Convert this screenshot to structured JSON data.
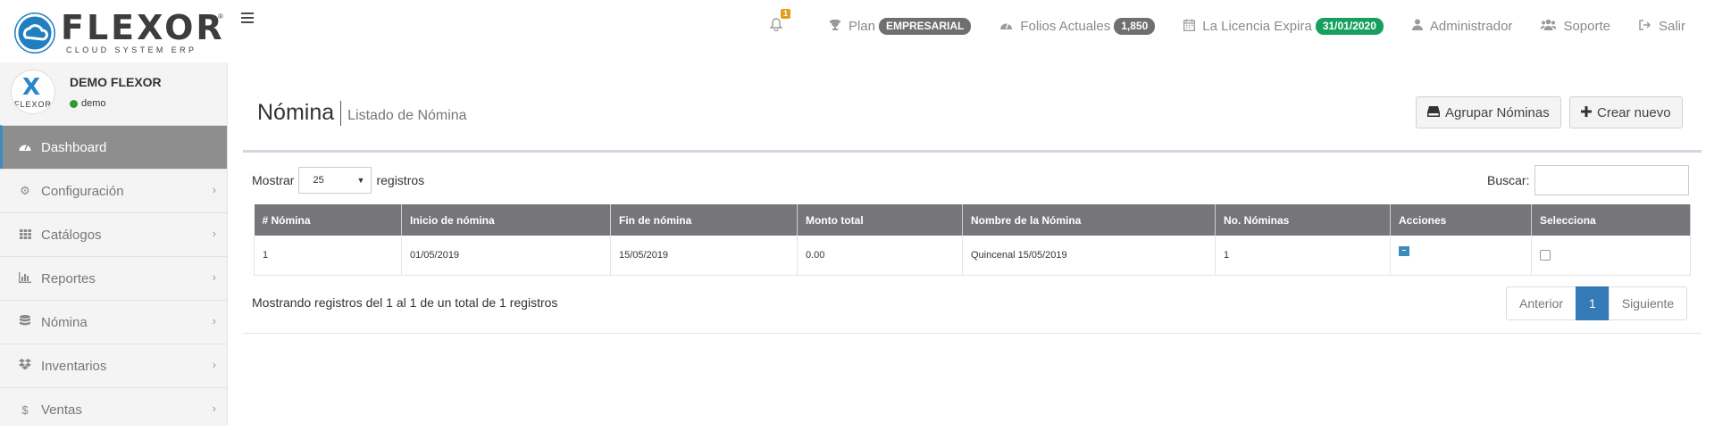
{
  "brand": {
    "name": "FLEXOR",
    "tagline": "CLOUD SYSTEM ERP",
    "reg": "®",
    "accent": "#1f7fc1"
  },
  "topnav": {
    "notifications_count": "1",
    "plan_label": "Plan",
    "plan_value": "EMPRESARIAL",
    "folios_label": "Folios Actuales",
    "folios_value": "1,850",
    "license_label": "La Licencia Expira",
    "license_value": "31/01/2020",
    "admin_label": "Administrador",
    "support_label": "Soporte",
    "logout_label": "Salir"
  },
  "user": {
    "avatar_letter": "X",
    "avatar_text": "FLEXOR",
    "name": "DEMO FLEXOR",
    "status": "demo"
  },
  "sidebar": {
    "items": [
      {
        "label": "Dashboard",
        "icon": "dashboard-icon"
      },
      {
        "label": "Configuración",
        "icon": "cogs-icon"
      },
      {
        "label": "Catálogos",
        "icon": "grid-icon"
      },
      {
        "label": "Reportes",
        "icon": "bar-chart-icon"
      },
      {
        "label": "Nómina",
        "icon": "database-icon"
      },
      {
        "label": "Inventarios",
        "icon": "dropbox-icon"
      },
      {
        "label": "Ventas",
        "icon": "dollar-icon"
      }
    ]
  },
  "page": {
    "title": "Nómina",
    "subtitle": "Listado de Nómina",
    "btn_agrupar": "Agrupar Nóminas",
    "btn_crear": "Crear nuevo"
  },
  "table_controls": {
    "show_label": "Mostrar",
    "page_size": "25",
    "records_label": "registros",
    "search_label": "Buscar:",
    "search_value": ""
  },
  "table": {
    "headers": [
      "# Nómina",
      "Inicio de nómina",
      "Fin de nómina",
      "Monto total",
      "Nombre de la Nómina",
      "No. Nóminas",
      "Acciones",
      "Selecciona"
    ],
    "rows": [
      [
        "1",
        "01/05/2019",
        "15/05/2019",
        "0.00",
        "Quincenal 15/05/2019",
        "1"
      ]
    ]
  },
  "footer": {
    "info": "Mostrando registros del 1 al 1 de un total de 1 registros",
    "prev": "Anterior",
    "page": "1",
    "next": "Siguiente"
  }
}
